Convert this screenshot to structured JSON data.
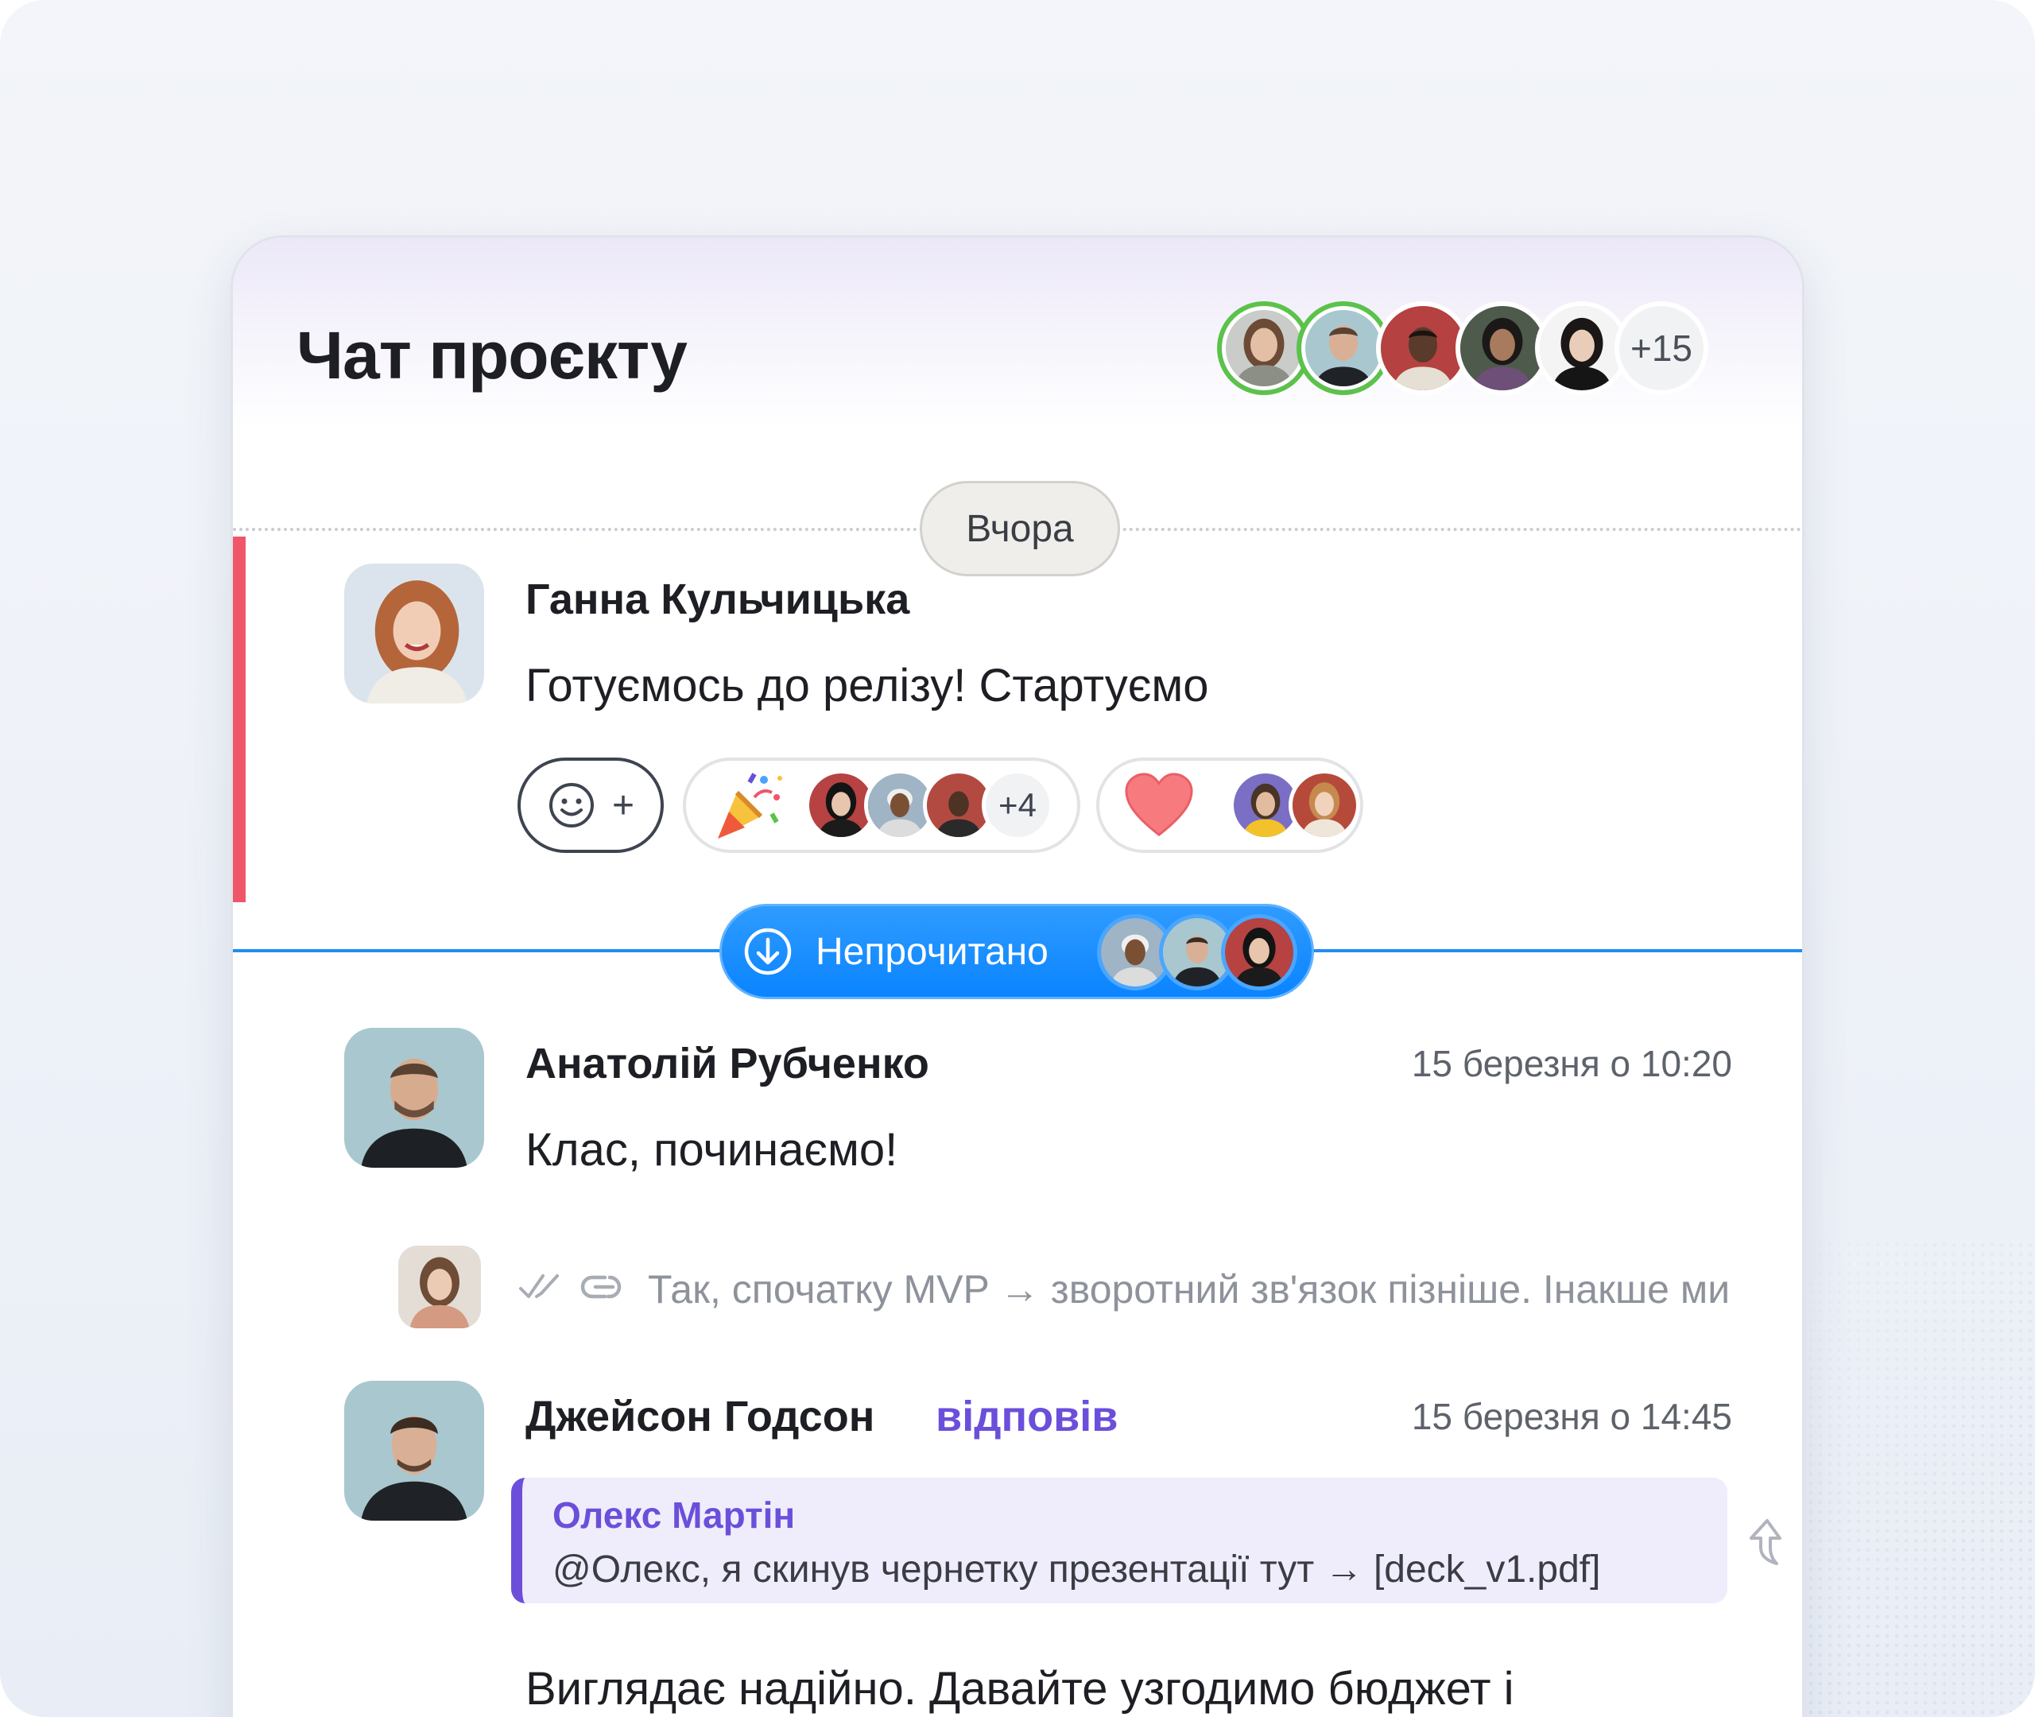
{
  "header": {
    "title": "Чат проєкту",
    "members_more": "+15"
  },
  "day_separator": "Вчора",
  "messages": [
    {
      "author": "Ганна Кульчицька",
      "text": "Готуємось до релізу! Стартуємо",
      "reactions": {
        "add_plus": "+",
        "party_count": "+4"
      }
    },
    {
      "author": "Анатолій Рубченко",
      "time": "15 березня о 10:20",
      "text": "Клас, починаємо!"
    },
    {
      "compact_text": "Так, спочатку MVP → зворотний зв'язок пізніше. Інакше ми"
    },
    {
      "author": "Джейсон Годсон",
      "replied_label": "відповів",
      "time": "15 березня о 14:45",
      "quote": {
        "author": "Олекс Мартін",
        "text": "@Олекс, я скинув чернетку презентації тут → [deck_v1.pdf]"
      },
      "text": "Виглядає надійно. Давайте узгодимо бюджет і"
    }
  ],
  "unread": {
    "label": "Непрочитано"
  },
  "colors": {
    "accent_blue": "#0a84ff",
    "unread_red": "#f0566a",
    "reply_purple": "#6b4fdb",
    "online_green": "#5bc24a"
  }
}
